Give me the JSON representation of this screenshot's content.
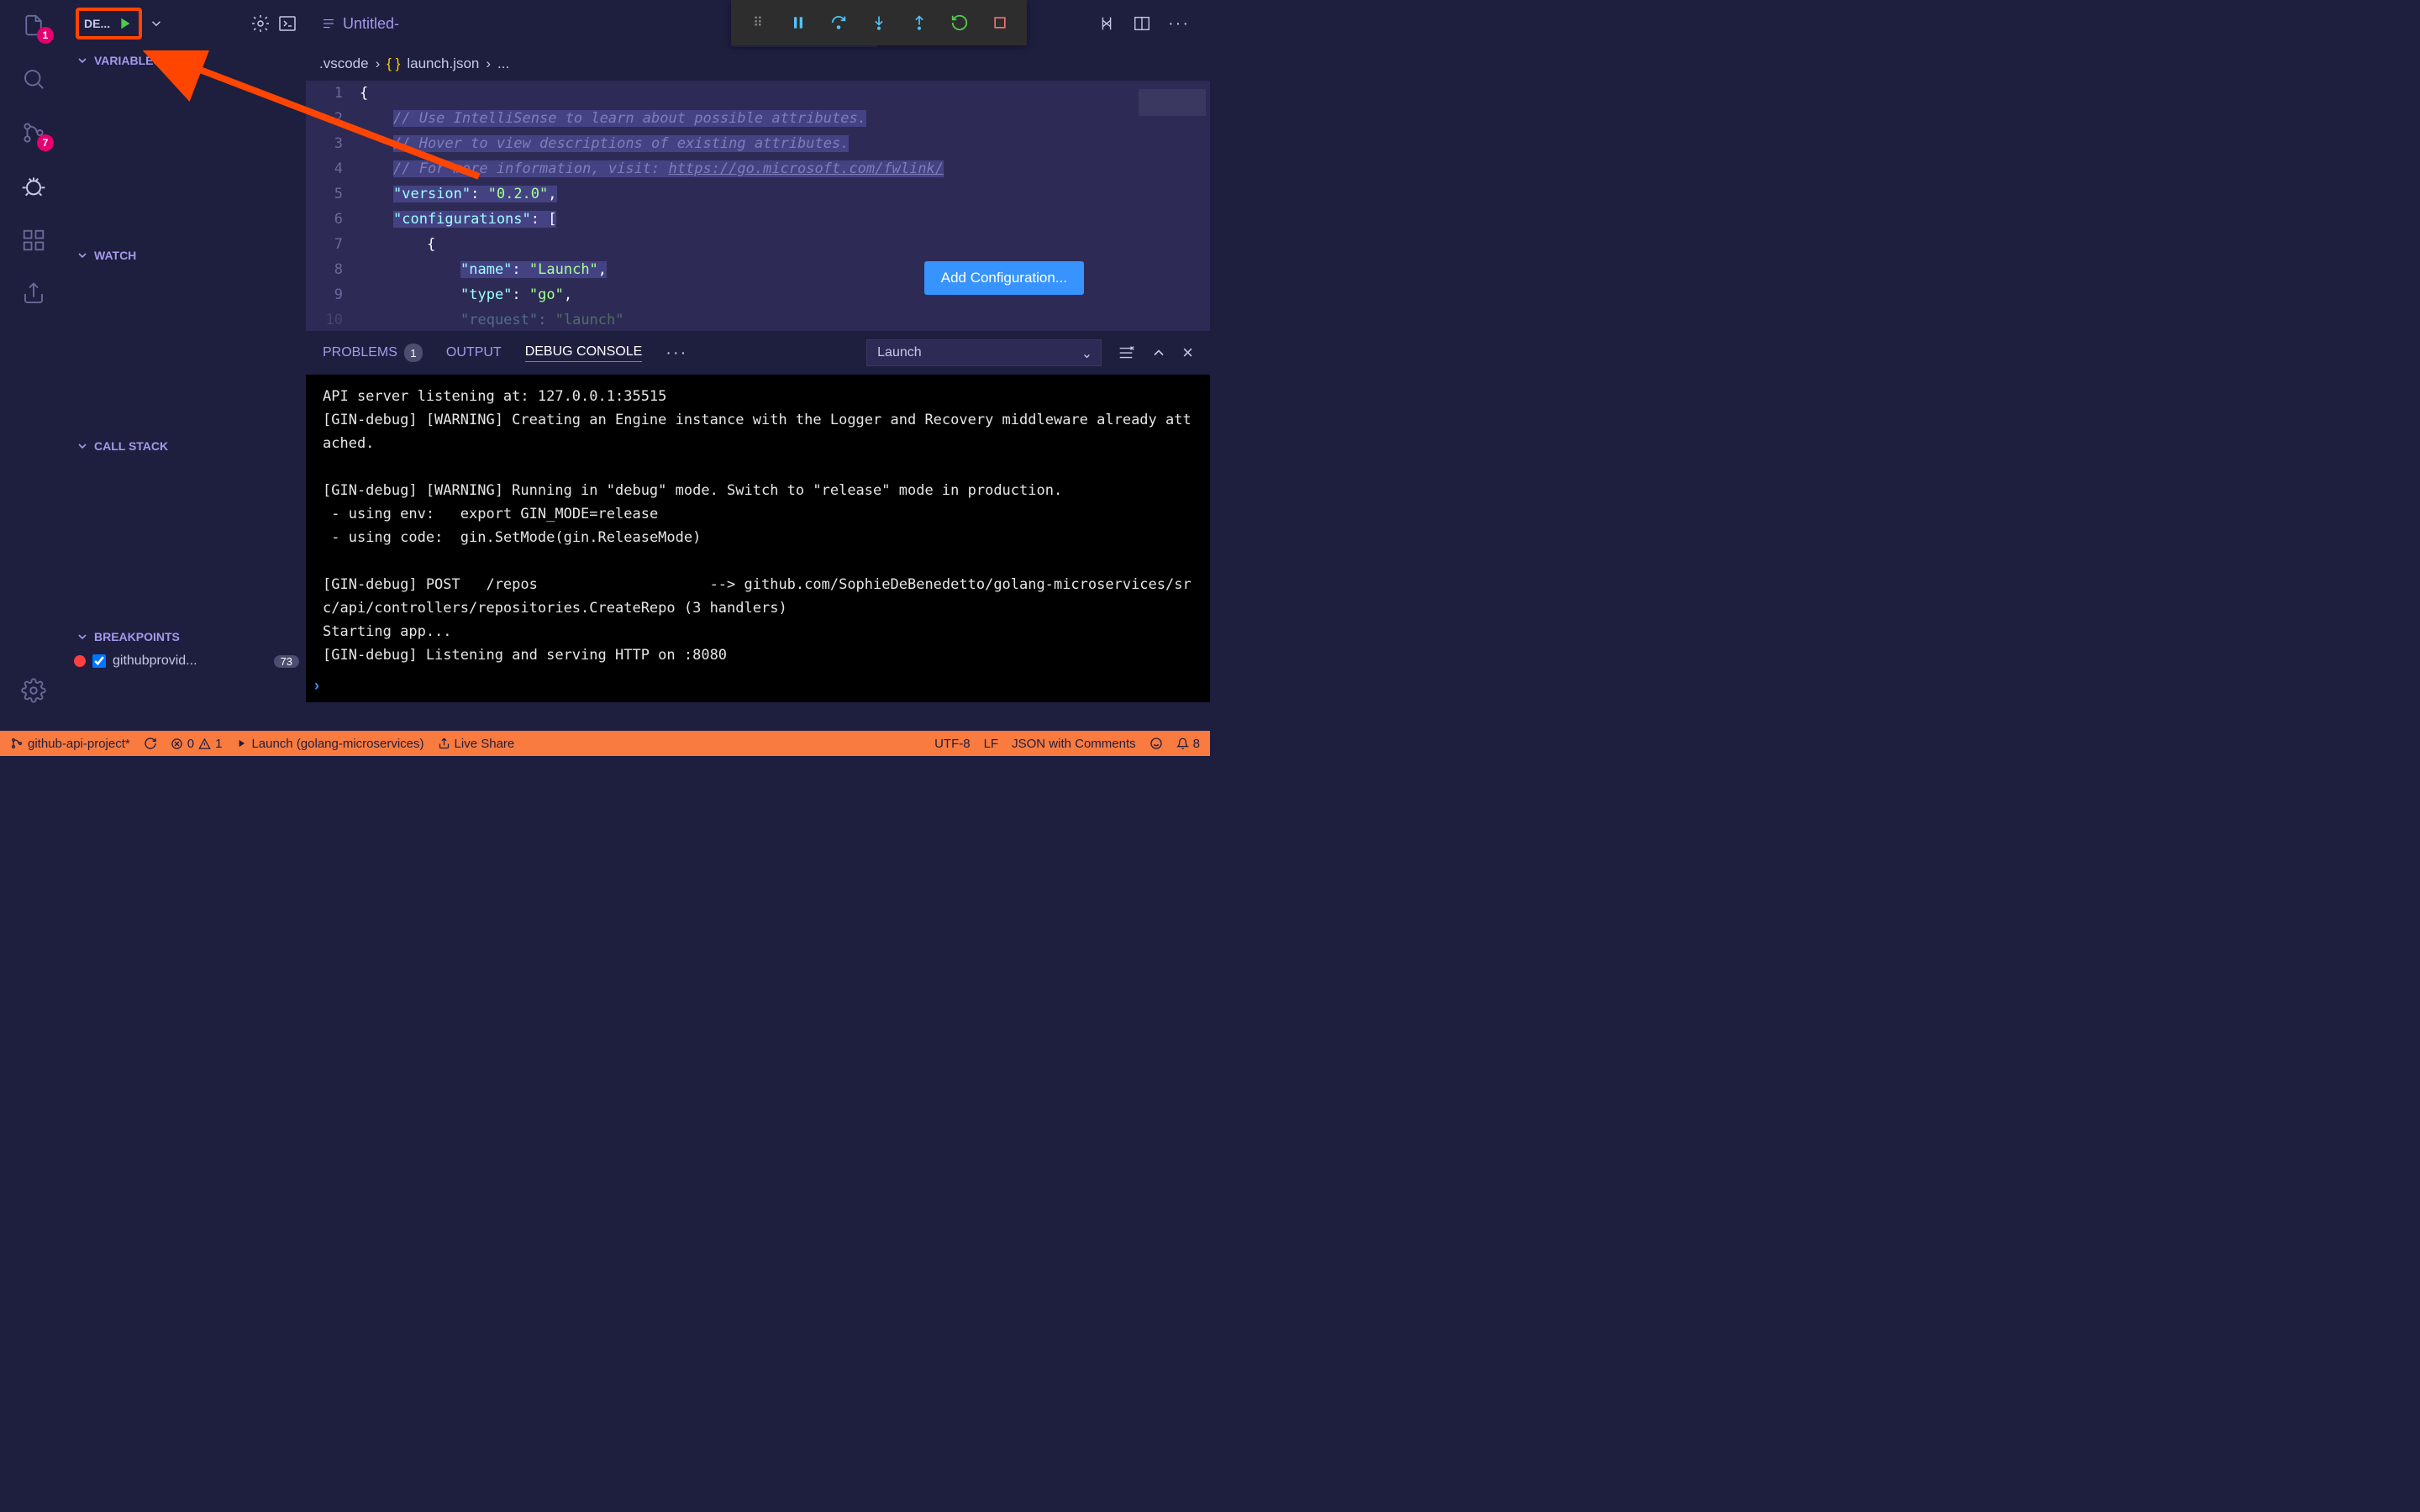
{
  "activity": {
    "explorer_badge": "1",
    "scm_badge": "7"
  },
  "sidebar": {
    "config_label": "DE...",
    "sections": {
      "variables": "Variables",
      "watch": "Watch",
      "callstack": "Call Stack",
      "breakpoints": "Breakpoints"
    },
    "breakpoint": {
      "label": "githubprovid...",
      "count": "73"
    }
  },
  "tabs": {
    "untitled": "Untitled-",
    "launch": "launch.json"
  },
  "breadcrumb": {
    "folder": ".vscode",
    "file": "launch.json",
    "tail": "..."
  },
  "code": {
    "lines": [
      "1",
      "2",
      "3",
      "4",
      "5",
      "6",
      "7",
      "8",
      "9",
      "10"
    ],
    "l1": "{",
    "l2": "// Use IntelliSense to learn about possible attributes.",
    "l3": "// Hover to view descriptions of existing attributes.",
    "l4_a": "// For more information, visit: ",
    "l4_b": "https://go.microsoft.com/fwlink/",
    "l5_k": "\"version\"",
    "l5_v": "\"0.2.0\"",
    "l5_p": ": ",
    "l5_c": ",",
    "l6_k": "\"configurations\"",
    "l6_p": ": [",
    "l7": "{",
    "l8_k": "\"name\"",
    "l8_v": "\"Launch\"",
    "l8_p": ": ",
    "l8_c": ",",
    "l9_k": "\"type\"",
    "l9_v": "\"go\"",
    "l9_p": ": ",
    "l9_c": ",",
    "l10_k": "\"request\"",
    "l10_v": "\"launch\"",
    "l10_p": ": ",
    "add_config_btn": "Add Configuration..."
  },
  "panel": {
    "tabs": {
      "problems": "PROBLEMS",
      "problems_count": "1",
      "output": "OUTPUT",
      "debug": "DEBUG CONSOLE"
    },
    "select_label": "Launch",
    "console_text": "API server listening at: 127.0.0.1:35515\n[GIN-debug] [WARNING] Creating an Engine instance with the Logger and Recovery middleware already attached.\n\n[GIN-debug] [WARNING] Running in \"debug\" mode. Switch to \"release\" mode in production.\n - using env:   export GIN_MODE=release\n - using code:  gin.SetMode(gin.ReleaseMode)\n\n[GIN-debug] POST   /repos                    --> github.com/SophieDeBenedetto/golang-microservices/src/api/controllers/repositories.CreateRepo (3 handlers)\nStarting app...\n[GIN-debug] Listening and serving HTTP on :8080"
  },
  "status": {
    "branch": "github-api-project*",
    "errors": "0",
    "warnings": "1",
    "launch": "Launch (golang-microservices)",
    "liveshare": "Live Share",
    "encoding": "UTF-8",
    "eol": "LF",
    "lang": "JSON with Comments",
    "bell": "8"
  }
}
